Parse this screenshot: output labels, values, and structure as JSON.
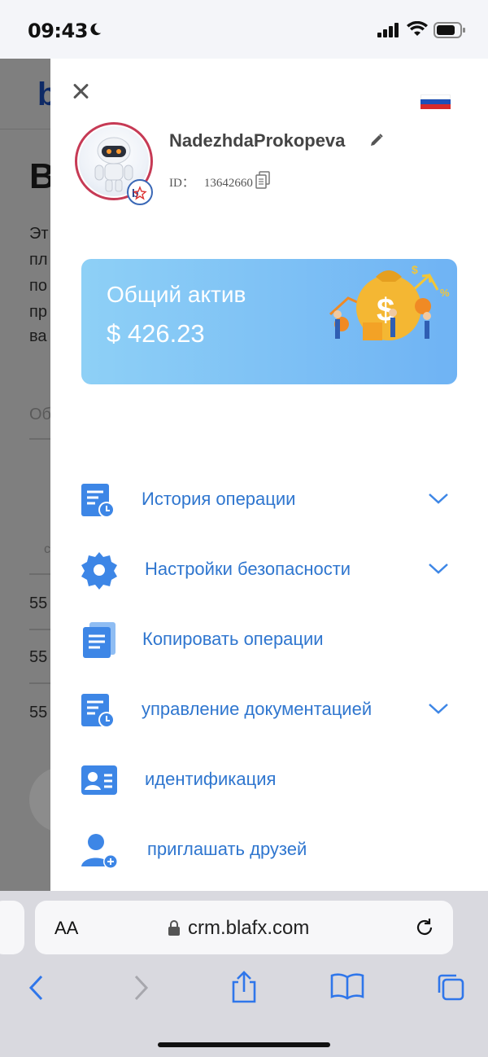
{
  "status_bar": {
    "time": "09:43"
  },
  "background_page": {
    "title_fragment": "В",
    "paragraph_fragments": [
      "Эт",
      "пл",
      "по",
      "пр",
      "ва"
    ],
    "tab_fragment": "Об",
    "table_header_fragment": "с",
    "row_fragments": [
      "55",
      "55",
      "55"
    ]
  },
  "drawer": {
    "user": {
      "name": "NadezhdaProkopeva",
      "id_label": "ID：",
      "id_value": "13642660"
    },
    "asset_card": {
      "label": "Общий актив",
      "value": "$ 426.23"
    },
    "menu": [
      {
        "label": "История операции",
        "icon": "history-doc-icon",
        "has_chevron": true
      },
      {
        "label": "Настройки безопасности",
        "icon": "gear-icon",
        "has_chevron": true
      },
      {
        "label": "Копировать операции",
        "icon": "copy-docs-icon",
        "has_chevron": false
      },
      {
        "label": "управление документацией",
        "icon": "doc-clock-icon",
        "has_chevron": true
      },
      {
        "label": "идентификация",
        "icon": "id-card-icon",
        "has_chevron": false
      },
      {
        "label": "приглашать друзей",
        "icon": "add-user-icon",
        "has_chevron": false
      }
    ],
    "accent_color": "#2f76cf"
  },
  "browser": {
    "aa_label": "AA",
    "url": "crm.blafx.com"
  }
}
